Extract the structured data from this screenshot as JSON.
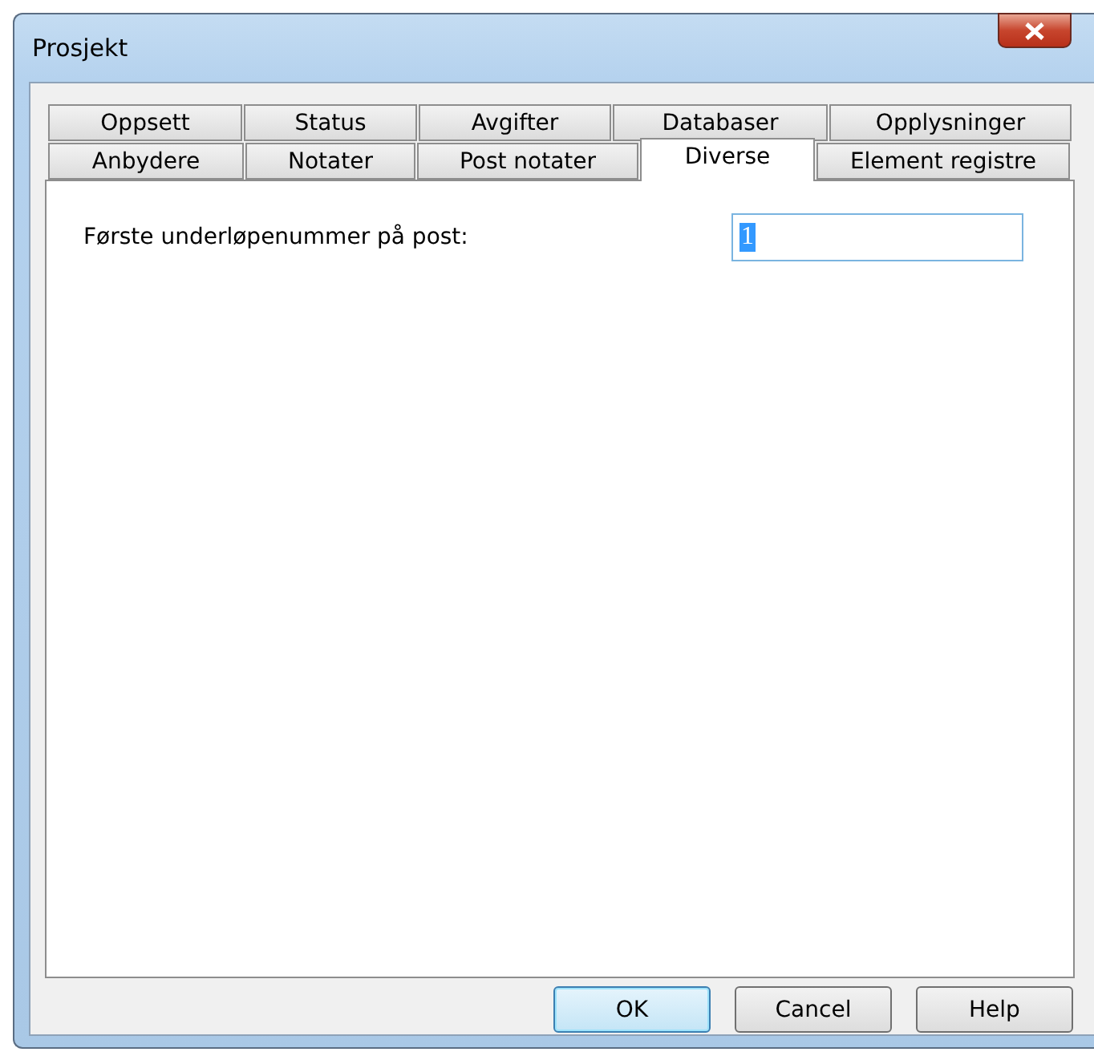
{
  "window": {
    "title": "Prosjekt"
  },
  "tab_rows": [
    [
      {
        "label": "Oppsett",
        "selected": false
      },
      {
        "label": "Status",
        "selected": false
      },
      {
        "label": "Avgifter",
        "selected": false
      },
      {
        "label": "Databaser",
        "selected": false
      },
      {
        "label": "Opplysninger",
        "selected": false
      }
    ],
    [
      {
        "label": "Anbydere",
        "selected": false
      },
      {
        "label": "Notater",
        "selected": false
      },
      {
        "label": "Post notater",
        "selected": false
      },
      {
        "label": "Diverse",
        "selected": true
      },
      {
        "label": "Element registre",
        "selected": false
      }
    ]
  ],
  "field": {
    "label": "Første underløpenummer på post:",
    "value": "1",
    "text_highlighted": true
  },
  "buttons": [
    {
      "label": "OK",
      "default": true
    },
    {
      "label": "Cancel",
      "default": false
    },
    {
      "label": "Help",
      "default": false
    }
  ]
}
